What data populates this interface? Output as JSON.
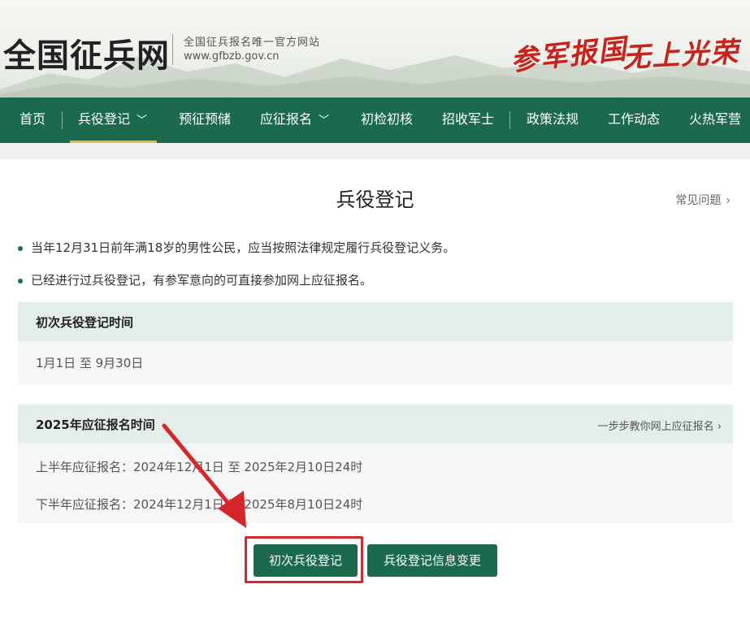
{
  "header": {
    "logo": "全国征兵网",
    "subtitle": "全国征兵报名唯一官方网站",
    "url": "www.gfbzb.gov.cn",
    "slogan_left": "参军报国",
    "slogan_right": "无上光荣"
  },
  "nav": {
    "items": [
      {
        "label": "首页"
      },
      {
        "label": "兵役登记"
      },
      {
        "label": "预征预储"
      },
      {
        "label": "应征报名"
      },
      {
        "label": "初检初核"
      },
      {
        "label": "招收军士"
      },
      {
        "label": "政策法规"
      },
      {
        "label": "工作动态"
      },
      {
        "label": "火热军营"
      }
    ],
    "dropdown_glyph": "﹀"
  },
  "main": {
    "title": "兵役登记",
    "faq_label": "常见问题",
    "faq_chevron": "›",
    "bullets": [
      "当年12月31日前年满18岁的男性公民，应当按照法律规定履行兵役登记义务。",
      "已经进行过兵役登记，有参军意向的可直接参加网上应征报名。"
    ],
    "first_registration": {
      "title": "初次兵役登记时间",
      "period": "1月1日 至 9月30日"
    },
    "enlistment": {
      "title": "2025年应征报名时间",
      "guide_link": "一步步教你网上应征报名",
      "guide_chevron": "›",
      "first_half": "上半年应征报名：2024年12月1日 至 2025年2月10日24时",
      "second_half": "下半年应征报名：2024年12月1日 至 2025年8月10日24时"
    },
    "buttons": {
      "first_register": "初次兵役登记",
      "change_info": "兵役登记信息变更"
    }
  },
  "colors": {
    "nav_green": "#1c6a4d",
    "accent_red": "#d7262a",
    "active_underline": "#e9b94a"
  }
}
